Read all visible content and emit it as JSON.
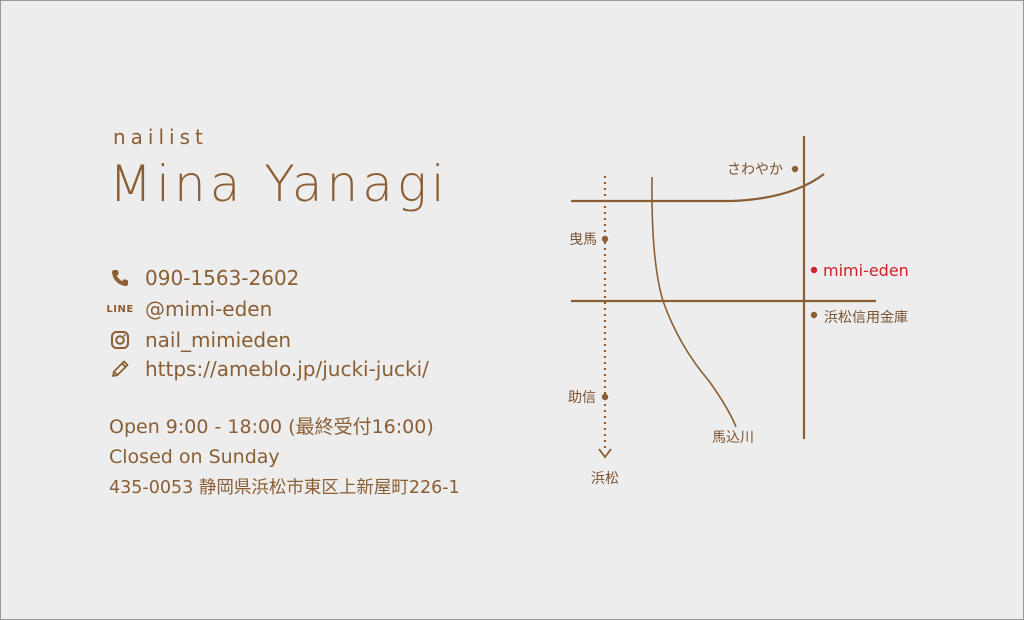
{
  "card": {
    "role": "nailist",
    "name": "Mina Yanagi",
    "contacts": [
      {
        "icon": "phone-icon",
        "text": "090-1563-2602"
      },
      {
        "icon": "line-icon",
        "icon_text": "LINE",
        "text": "@mimi-eden"
      },
      {
        "icon": "instagram-icon",
        "text": "nail_mimieden"
      },
      {
        "icon": "pencil-icon",
        "text": "https://ameblo.jp/jucki-jucki/"
      }
    ],
    "hours": "Open 9:00 - 18:00 (最終受付16:00)",
    "closed": "Closed on Sunday",
    "address": "435-0053 静岡県浜松市東区上新屋町226-1"
  },
  "map": {
    "labels": {
      "sawayaka": "さわやか",
      "hikuma": "曳馬",
      "shop": "mimi-eden",
      "bank": "浜松信用金庫",
      "sukenobu": "助信",
      "river": "馬込川",
      "hamamatsu": "浜松"
    }
  },
  "colors": {
    "brown": "#8b5e34",
    "highlight_red": "#d0202a",
    "card_bg": "#ededed"
  }
}
